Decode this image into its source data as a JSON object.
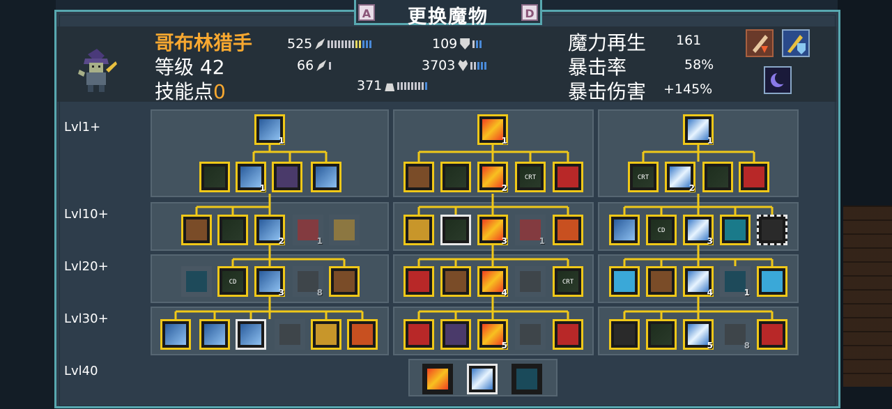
{
  "title": "更换魔物",
  "keys": {
    "left": "A",
    "right": "D"
  },
  "monster": {
    "name": "哥布林猎手",
    "level_label": "等级",
    "level": "42",
    "skill_points_label": "技能点",
    "skill_points": "0"
  },
  "stats": {
    "attack": "525",
    "defense": "109",
    "magic": "66",
    "hp": "3703",
    "speed": "371"
  },
  "right_stats": {
    "mana_regen_label": "魔力再生",
    "mana_regen": "161",
    "crit_rate_label": "暴击率",
    "crit_rate": "58%",
    "crit_damage_label": "暴击伤害",
    "crit_damage": "+145%"
  },
  "row_labels": [
    "Lvl1+",
    "Lvl10+",
    "Lvl20+",
    "Lvl30+",
    "Lvl40"
  ],
  "skill_badges": {
    "t1_r1_root": "1",
    "t1_r1_b2": "1",
    "t1_r2_b3": "2",
    "t1_r2_dim": "1",
    "t1_r3_b3": "3",
    "t1_r3_dim": "8",
    "t2_r1_root": "1",
    "t2_r1_c3": "2",
    "t2_r2_c3": "3",
    "t2_r2_dim": "1",
    "t2_r3_c3": "4",
    "t2_r4_c3": "5",
    "t3_r1_root": "1",
    "t3_r1_c2": "2",
    "t3_r2_c3": "3",
    "t3_r3_c3": "4",
    "t3_r3_c4": "1",
    "t3_r4_c3": "5",
    "t3_r4_dim": "8"
  },
  "icon_labels": {
    "crt": "CRT",
    "cd": "CD"
  },
  "colors": {
    "accent": "#f8a830",
    "border": "#58a8b0",
    "skill_border": "#f0c818"
  }
}
